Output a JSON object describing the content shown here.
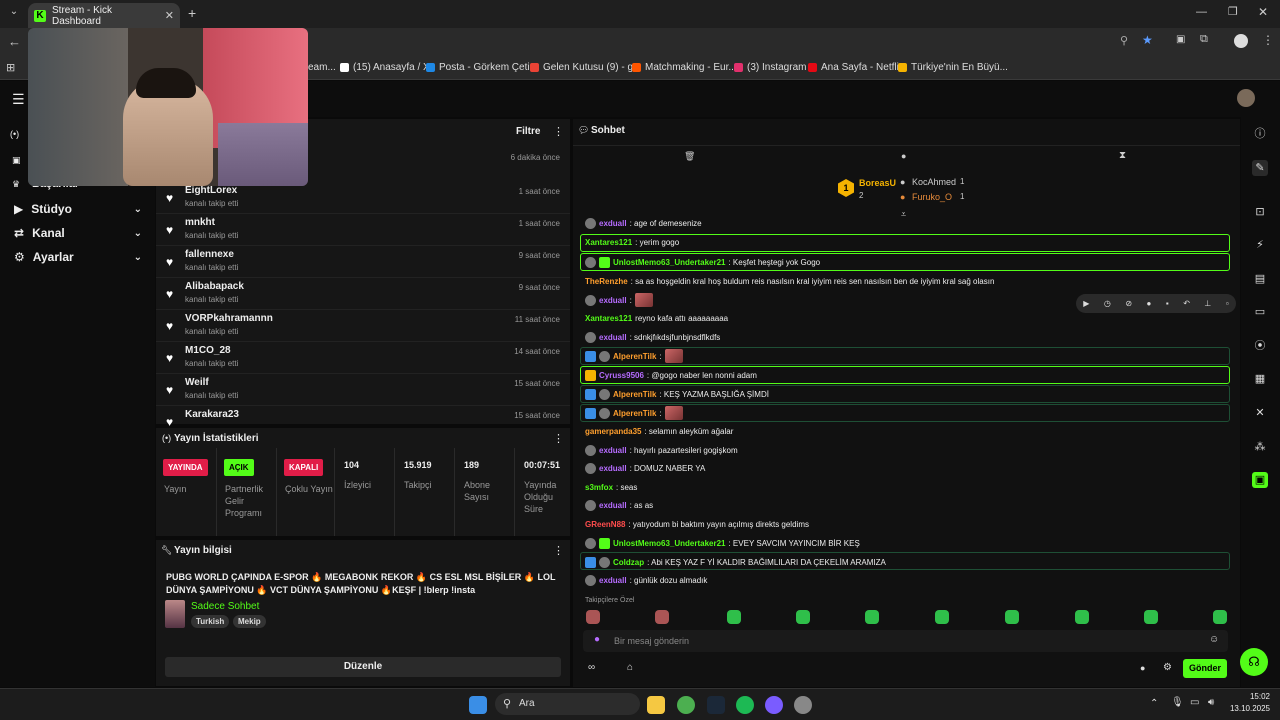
{
  "browser": {
    "tab_title": "Stream - Kick Dashboard",
    "bookmarks": [
      {
        "label": "eam...",
        "color": "#8a2be2"
      },
      {
        "label": "(15) Anasayfa / X",
        "color": "#ffffff"
      },
      {
        "label": "Posta - Görkem Çeti...",
        "color": "#1e88e5"
      },
      {
        "label": "Gelen Kutusu (9) - g...",
        "color": "#ea4335"
      },
      {
        "label": "Matchmaking - Eur...",
        "color": "#ff5500"
      },
      {
        "label": "(3) Instagram",
        "color": "#e1306c"
      },
      {
        "label": "Ana Sayfa - Netflix",
        "color": "#e50914"
      },
      {
        "label": "Türkiye'nin En Büyü...",
        "color": "#f5b301"
      }
    ]
  },
  "sidebar": {
    "partial_label": "Başarılar",
    "items": [
      {
        "label": "Stüdyo"
      },
      {
        "label": "Kanal"
      },
      {
        "label": "Ayarlar"
      }
    ]
  },
  "activity": {
    "filter_label": "Filtre",
    "first_time": "6 dakika önce",
    "rows": [
      {
        "name": "EightLorex",
        "sub": "kanalı takip etti",
        "time": "1 saat önce"
      },
      {
        "name": "mnkht",
        "sub": "kanalı takip etti",
        "time": "1 saat önce"
      },
      {
        "name": "fallennexe",
        "sub": "kanalı takip etti",
        "time": "9 saat önce"
      },
      {
        "name": "Alibabapack",
        "sub": "kanalı takip etti",
        "time": "9 saat önce"
      },
      {
        "name": "VORPkahramannn",
        "sub": "kanalı takip etti",
        "time": "11 saat önce"
      },
      {
        "name": "M1CO_28",
        "sub": "kanalı takip etti",
        "time": "14 saat önce"
      },
      {
        "name": "Weilf",
        "sub": "kanalı takip etti",
        "time": "15 saat önce"
      },
      {
        "name": "Karakara23",
        "sub": "",
        "time": "15 saat önce"
      }
    ]
  },
  "stats": {
    "title": "Yayın İstatistikleri",
    "cols": [
      {
        "badge": "YAYINDA",
        "badge_color": "#e11d48",
        "label": "Yayın"
      },
      {
        "badge": "AÇIK",
        "badge_color": "#53fc18",
        "label": "Partnerlik Gelir Programı"
      },
      {
        "badge": "KAPALI",
        "badge_color": "#e11d48",
        "label": "Çoklu Yayın"
      },
      {
        "value": "104",
        "label": "İzleyici"
      },
      {
        "value": "15.919",
        "label": "Takipçi"
      },
      {
        "value": "189",
        "label": "Abone Sayısı"
      },
      {
        "value": "00:07:51",
        "label": "Yayında Olduğu Süre"
      }
    ]
  },
  "info": {
    "title": "Yayın bilgisi",
    "stream_title": "PUBG WORLD ÇAPINDA E-SPOR 🔥 MEGABONK REKOR 🔥 CS ESL MSL BİŞİLER 🔥 LOL DÜNYA ŞAMPİYONU 🔥 VCT DÜNYA ŞAMPİYONU 🔥KEŞF | !blerp !insta",
    "category": "Sadece Sohbet",
    "tags": [
      "Turkish",
      "Mekip"
    ],
    "edit_button": "Düzenle"
  },
  "chat": {
    "title": "Sohbet",
    "leaderboard": {
      "first": {
        "rank": "1",
        "name": "BoreasU",
        "count": "2"
      },
      "second": {
        "name": "KocAhmed",
        "count": "1"
      },
      "third": {
        "name": "Furuko_O",
        "count": "1"
      }
    },
    "messages": [
      {
        "user": "exduall",
        "color": "#b66cff",
        "text": ": age of demesenize"
      },
      {
        "user": "Xantares121",
        "color": "#53fc18",
        "text": ": yerim gogo"
      },
      {
        "user": "UnlostMemo63_Undertaker21",
        "color": "#53fc18",
        "text": ": Keşfet heştegi yok Gogo"
      },
      {
        "user": "TheRenzhe",
        "color": "#ff9f2e",
        "text": ": sa as hoşgeldin kral hoş buldum reis nasılsın kral iyiyim reis sen nasılsın ben de iyiyim kral sağ olasın"
      },
      {
        "user": "exduall",
        "color": "#b66cff",
        "text": ":"
      },
      {
        "user": "Xantares121",
        "color": "#53fc18",
        "text": "  reyno kafa attı aaaaaaaaa"
      },
      {
        "user": "exduall",
        "color": "#b66cff",
        "text": ": sdnkjfıkdsjfunbjnsdflkdfs"
      },
      {
        "user": "AlperenTilk",
        "color": "#ff9f2e",
        "text": ":"
      },
      {
        "user": "Cyruss9506",
        "color": "#b66cff",
        "text": ": @gogo naber len nonni adam"
      },
      {
        "user": "AlperenTilk",
        "color": "#ff9f2e",
        "text": ": KEŞ YAZMA BAŞLIĞA ŞİMDİ"
      },
      {
        "user": "AlperenTilk",
        "color": "#ff9f2e",
        "text": ":"
      },
      {
        "user": "gamerpanda35",
        "color": "#ff9f2e",
        "text": ": selamın aleyküm ağalar"
      },
      {
        "user": "exduall",
        "color": "#b66cff",
        "text": ": hayırlı pazartesileri gogişkom"
      },
      {
        "user": "exduall",
        "color": "#b66cff",
        "text": ": DOMUZ NABER YA"
      },
      {
        "user": "s3mfox",
        "color": "#53fc18",
        "text": ": seas"
      },
      {
        "user": "exduall",
        "color": "#b66cff",
        "text": ": as as"
      },
      {
        "user": "GReenN88",
        "color": "#ff4d4d",
        "text": ": yatıyodum bi baktım yayın açılmış direkts geldims"
      },
      {
        "user": "UnlostMemo63_Undertaker21",
        "color": "#53fc18",
        "text": ": EVEY SAVCIM YAYINCIM BİR KEŞ"
      },
      {
        "user": "Coldzap",
        "color": "#53fc18",
        "text": ": Abi KEŞ YAZ F Yİ KALDIR BAĞIMLILARI DA ÇEKELİM ARAMIZA"
      },
      {
        "user": "exduall",
        "color": "#b66cff",
        "text": ": günlük dozu almadık"
      }
    ],
    "emote_section": "Takipçilere Özel",
    "input_placeholder": "Bir mesaj gönderin",
    "send_button": "Gönder"
  },
  "taskbar": {
    "search_label": "Ara",
    "time": "15:02",
    "date": "13.10.2025"
  },
  "colors": {
    "accent": "#53fc18",
    "panel": "#161616",
    "bg": "#0d0d0d"
  }
}
